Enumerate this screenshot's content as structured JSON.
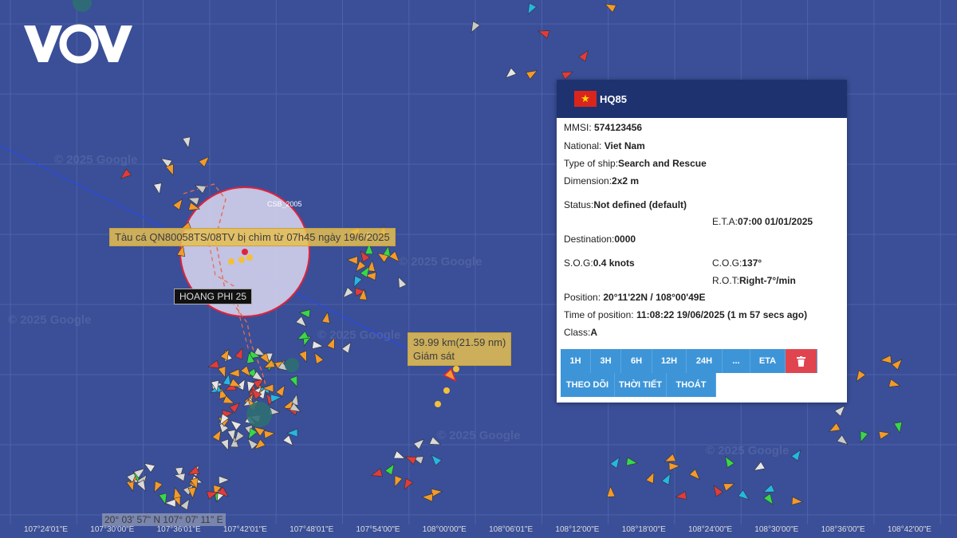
{
  "brand": {
    "logo_text": "VOV"
  },
  "map": {
    "watermark": "© 2025 Google",
    "labels": {
      "sink_notice": "Tàu cá QN80058TS/08TV bị chìm từ 07h45 ngày 19/6/2025",
      "distance": "39.99 km(21.59 nm)",
      "monitor": "Giám sát",
      "vessel_hoang": "HOANG PHI 25",
      "vessel_csb": "CSB_2005"
    },
    "cursor_coordinates": "20° 03' 57\" N 107° 07' 11\" E",
    "longitude_ticks": [
      "107°24'01\"E",
      "107°30'00\"E",
      "107°36'01\"E",
      "107°42'01\"E",
      "107°48'01\"E",
      "107°54'00\"E",
      "108°00'00\"E",
      "108°06'01\"E",
      "108°12'00\"E",
      "108°18'00\"E",
      "108°24'00\"E",
      "108°30'00\"E",
      "108°36'00\"E",
      "108°42'00\"E"
    ]
  },
  "ship_panel": {
    "name": "HQ85",
    "flag_icon": "vietnam-flag-icon",
    "mmsi_label": "MMSI:",
    "mmsi": "574123456",
    "nationality_label": "National:",
    "nationality": "Viet Nam",
    "type_label": "Type of ship:",
    "type": "Search and Rescue",
    "dimension_label": "Dimension:",
    "dimension": "2x2 m",
    "status_label": "Status:",
    "status": "Not defined (default)",
    "eta_label": "E.T.A:",
    "eta": "07:00 01/01/2025",
    "destination_label": "Destination:",
    "destination": "0000",
    "sog_label": "S.O.G:",
    "sog": "0.4 knots",
    "cog_label": "C.O.G:",
    "cog": "137°",
    "rot_label": "R.O.T:",
    "rot": "Right-7°/min",
    "position_label": "Position:",
    "position": "20°11'22N / 108°00'49E",
    "time_label": "Time of position:",
    "time": "11:08:22 19/06/2025 (1 m 57 secs ago)",
    "class_label": "Class:",
    "class": "A",
    "track_buttons": [
      "1H",
      "3H",
      "6H",
      "12H",
      "24H",
      "...",
      "ETA"
    ],
    "action_buttons": [
      "THEO DÕI",
      "THỜI TIẾT",
      "THOÁT"
    ],
    "colors": {
      "header": "#1e3270",
      "button": "#3d95d8",
      "delete": "#e0454f"
    }
  }
}
